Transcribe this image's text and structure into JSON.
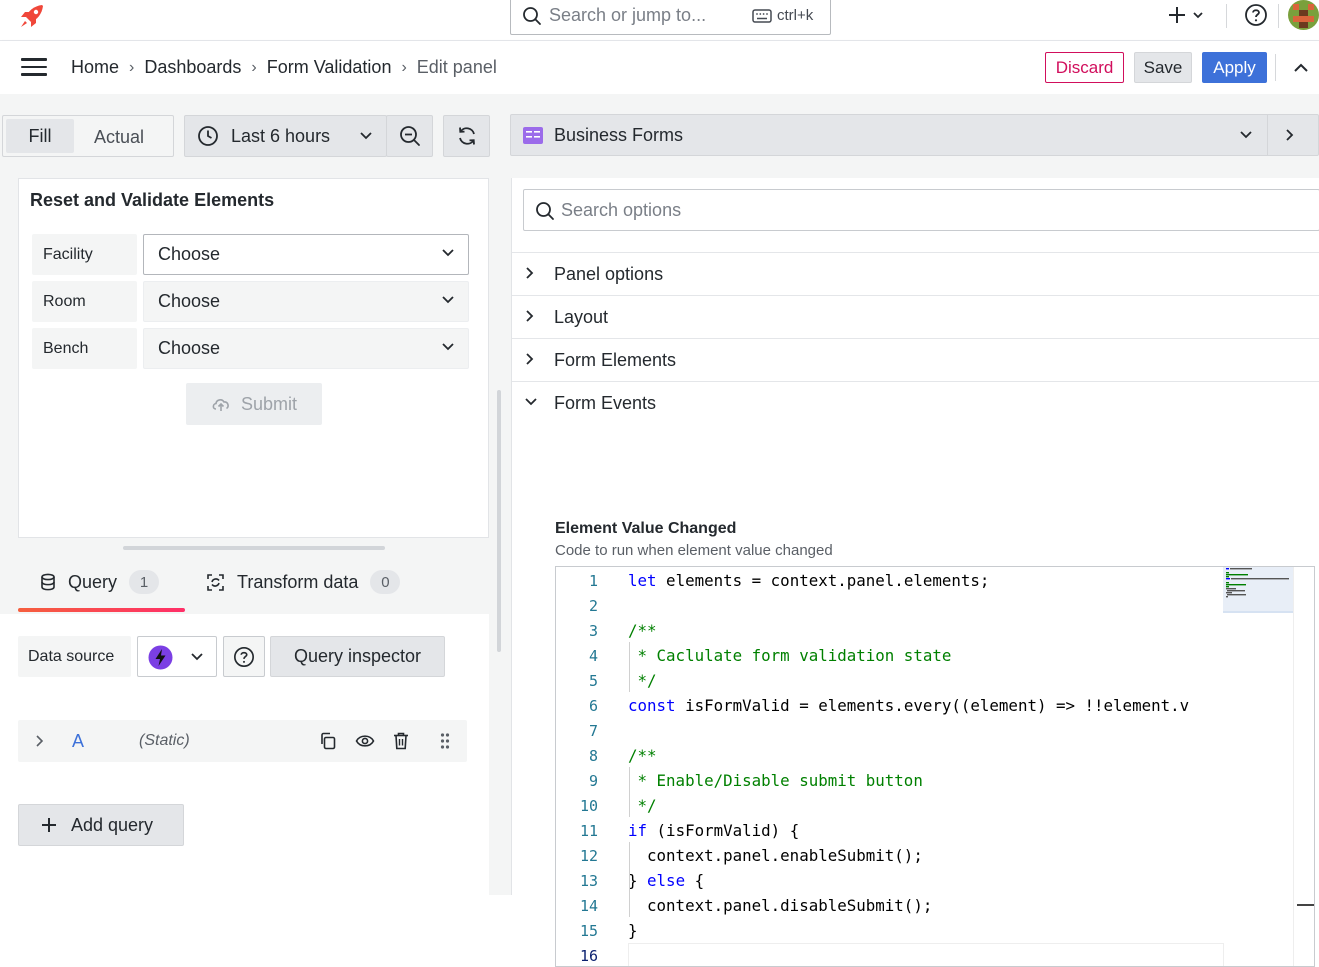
{
  "topbar": {
    "search_placeholder": "Search or jump to...",
    "search_shortcut": "ctrl+k"
  },
  "nav": {
    "breadcrumbs": [
      "Home",
      "Dashboards",
      "Form Validation",
      "Edit panel"
    ],
    "discard_label": "Discard",
    "save_label": "Save",
    "apply_label": "Apply"
  },
  "toolbar": {
    "fill_label": "Fill",
    "actual_label": "Actual",
    "time_range": "Last 6 hours"
  },
  "panel": {
    "title": "Reset and Validate Elements",
    "rows": [
      {
        "label": "Facility",
        "value": "Choose"
      },
      {
        "label": "Room",
        "value": "Choose"
      },
      {
        "label": "Bench",
        "value": "Choose"
      }
    ],
    "submit_label": "Submit"
  },
  "query_tabs": {
    "query_label": "Query",
    "query_count": "1",
    "transform_label": "Transform data",
    "transform_count": "0"
  },
  "query": {
    "data_source_label": "Data source",
    "inspector_label": "Query inspector",
    "row_letter": "A",
    "row_type": "(Static)",
    "add_label": "Add query"
  },
  "visualization": {
    "name": "Business Forms"
  },
  "options": {
    "search_placeholder": "Search options",
    "sections": [
      "Panel options",
      "Layout",
      "Form Elements",
      "Form Events"
    ],
    "event_title": "Element Value Changed",
    "event_desc": "Code to run when element value changed"
  },
  "code": {
    "line_numbers": [
      "1",
      "2",
      "3",
      "4",
      "5",
      "6",
      "7",
      "8",
      "9",
      "10",
      "11",
      "12",
      "13",
      "14",
      "15",
      "16"
    ],
    "l1_kw": "let",
    "l1_rest": " elements = context.panel.elements;",
    "l3": "/**",
    "l4": " * Caclulate form validation state",
    "l5": " */",
    "l6_kw": "const",
    "l6_rest": " isFormValid = elements.every((element) => !!element.v",
    "l8": "/**",
    "l9": " * Enable/Disable submit button",
    "l10": " */",
    "l11_kw": "if",
    "l11_rest": " (isFormValid) {",
    "l12": "  context.panel.enableSubmit();",
    "l13_a": "} ",
    "l13_kw": "else",
    "l13_b": " {",
    "l14": "  context.panel.disableSubmit();",
    "l15": "}"
  },
  "colors": {
    "primary": "#3d71d9",
    "discard": "#d10e5c",
    "keyword": "#0000ff",
    "comment": "#008000",
    "line_number": "#237893"
  }
}
